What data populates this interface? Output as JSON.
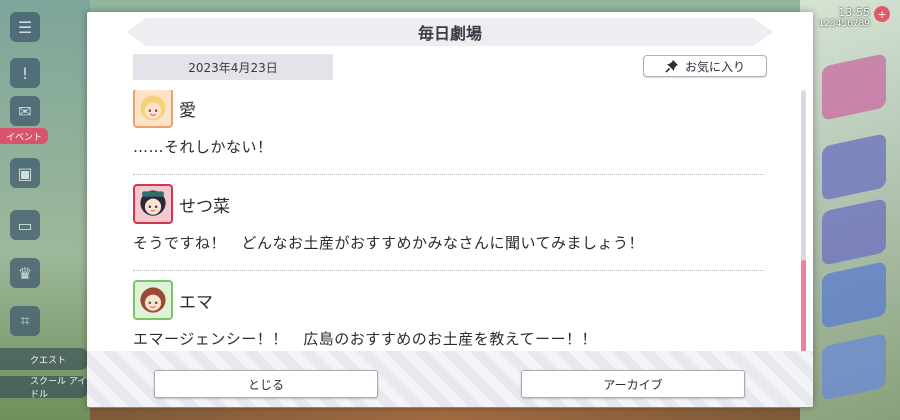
{
  "background": {
    "status_line1": "13:55",
    "status_line2": "123456789",
    "event_tag": "イベント",
    "menu_labels": [
      "クエスト",
      "スクール\nアイドル"
    ]
  },
  "dialog": {
    "title": "毎日劇場",
    "date": "2023年4月23日",
    "favorite_label": "お気に入り",
    "entries": [
      {
        "speaker": "愛",
        "text": "……それしかない！",
        "avatar_color": "#f0a070"
      },
      {
        "speaker": "せつ菜",
        "text": "そうですね！　どんなお土産がおすすめかみなさんに聞いてみましょう！",
        "avatar_color": "#d8344a"
      },
      {
        "speaker": "エマ",
        "text": "エマージェンシー！！　広島のおすすめのお土産を教えてーー！！",
        "avatar_color": "#7cc46a"
      }
    ],
    "close_label": "とじる",
    "archive_label": "アーカイブ"
  },
  "colors": {
    "scroll_thumb": "#ec8196",
    "title_bg": "#eceef2"
  }
}
